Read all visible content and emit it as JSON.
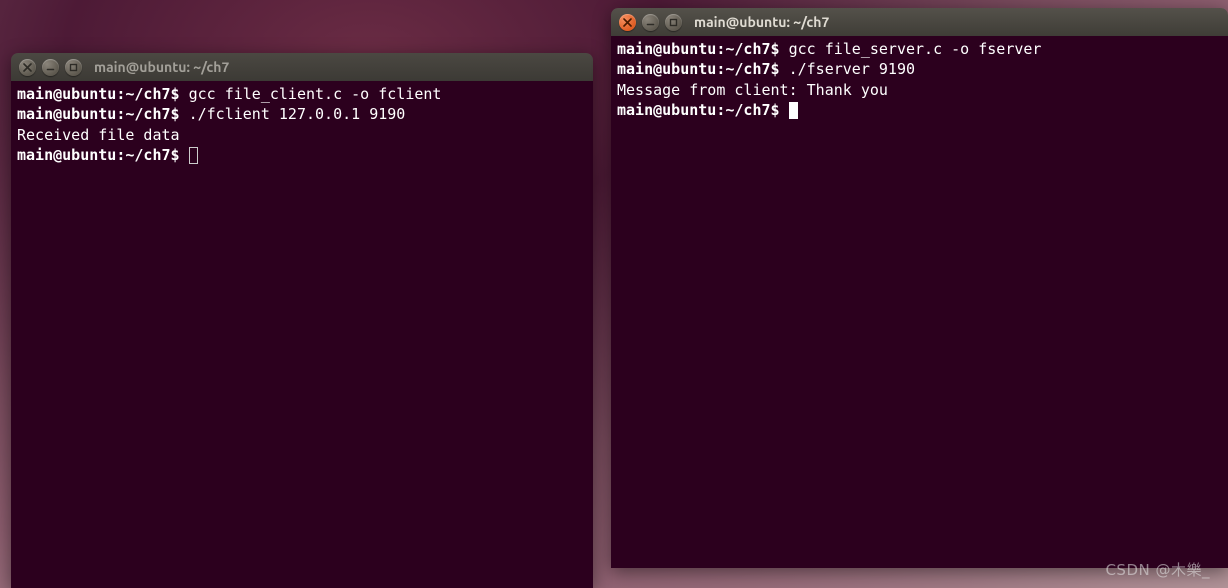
{
  "windows": {
    "left": {
      "title": "main@ubuntu: ~/ch7",
      "active": false,
      "lines": [
        {
          "prompt": "main@ubuntu:~/ch7$",
          "cmd": " gcc file_client.c -o fclient"
        },
        {
          "prompt": "main@ubuntu:~/ch7$",
          "cmd": " ./fclient 127.0.0.1 9190"
        },
        {
          "out": "Received file data"
        },
        {
          "prompt": "main@ubuntu:~/ch7$",
          "cmd": " ",
          "cursor": "outline"
        }
      ]
    },
    "right": {
      "title": "main@ubuntu: ~/ch7",
      "active": true,
      "lines": [
        {
          "prompt": "main@ubuntu:~/ch7$",
          "cmd": " gcc file_server.c -o fserver"
        },
        {
          "prompt": "main@ubuntu:~/ch7$",
          "cmd": " ./fserver 9190"
        },
        {
          "out": "Message from client: Thank you"
        },
        {
          "prompt": "main@ubuntu:~/ch7$",
          "cmd": " ",
          "cursor": "block"
        }
      ]
    }
  },
  "watermark": "CSDN @木樂_"
}
